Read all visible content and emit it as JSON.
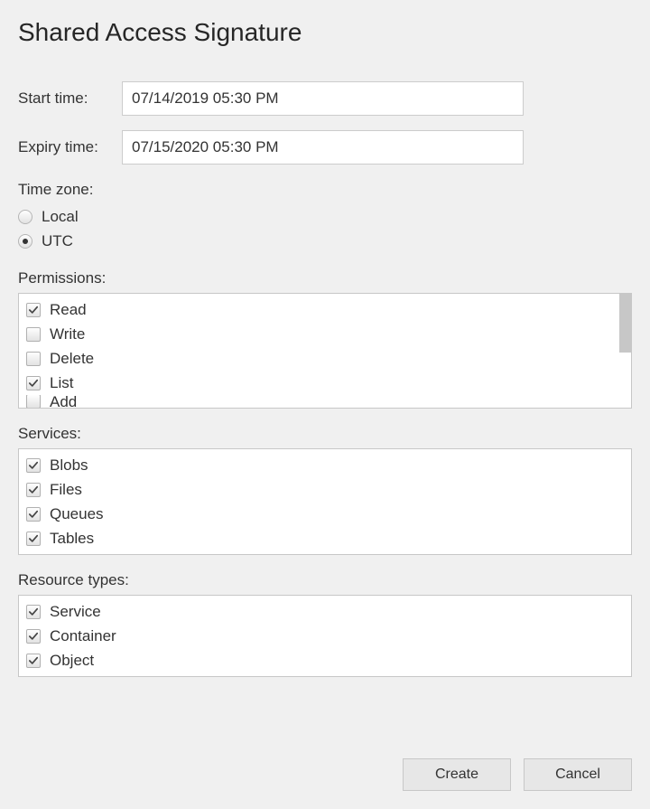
{
  "title": "Shared Access Signature",
  "start": {
    "label": "Start time:",
    "value": "07/14/2019 05:30 PM"
  },
  "expiry": {
    "label": "Expiry time:",
    "value": "07/15/2020 05:30 PM"
  },
  "timezone": {
    "label": "Time zone:",
    "options": [
      {
        "label": "Local",
        "checked": false
      },
      {
        "label": "UTC",
        "checked": true
      }
    ]
  },
  "permissions": {
    "label": "Permissions:",
    "items": [
      {
        "label": "Read",
        "checked": true
      },
      {
        "label": "Write",
        "checked": false
      },
      {
        "label": "Delete",
        "checked": false
      },
      {
        "label": "List",
        "checked": true
      },
      {
        "label": "Add",
        "checked": false
      }
    ]
  },
  "services": {
    "label": "Services:",
    "items": [
      {
        "label": "Blobs",
        "checked": true
      },
      {
        "label": "Files",
        "checked": true
      },
      {
        "label": "Queues",
        "checked": true
      },
      {
        "label": "Tables",
        "checked": true
      }
    ]
  },
  "resourcetypes": {
    "label": "Resource types:",
    "items": [
      {
        "label": "Service",
        "checked": true
      },
      {
        "label": "Container",
        "checked": true
      },
      {
        "label": "Object",
        "checked": true
      }
    ]
  },
  "buttons": {
    "create": "Create",
    "cancel": "Cancel"
  }
}
